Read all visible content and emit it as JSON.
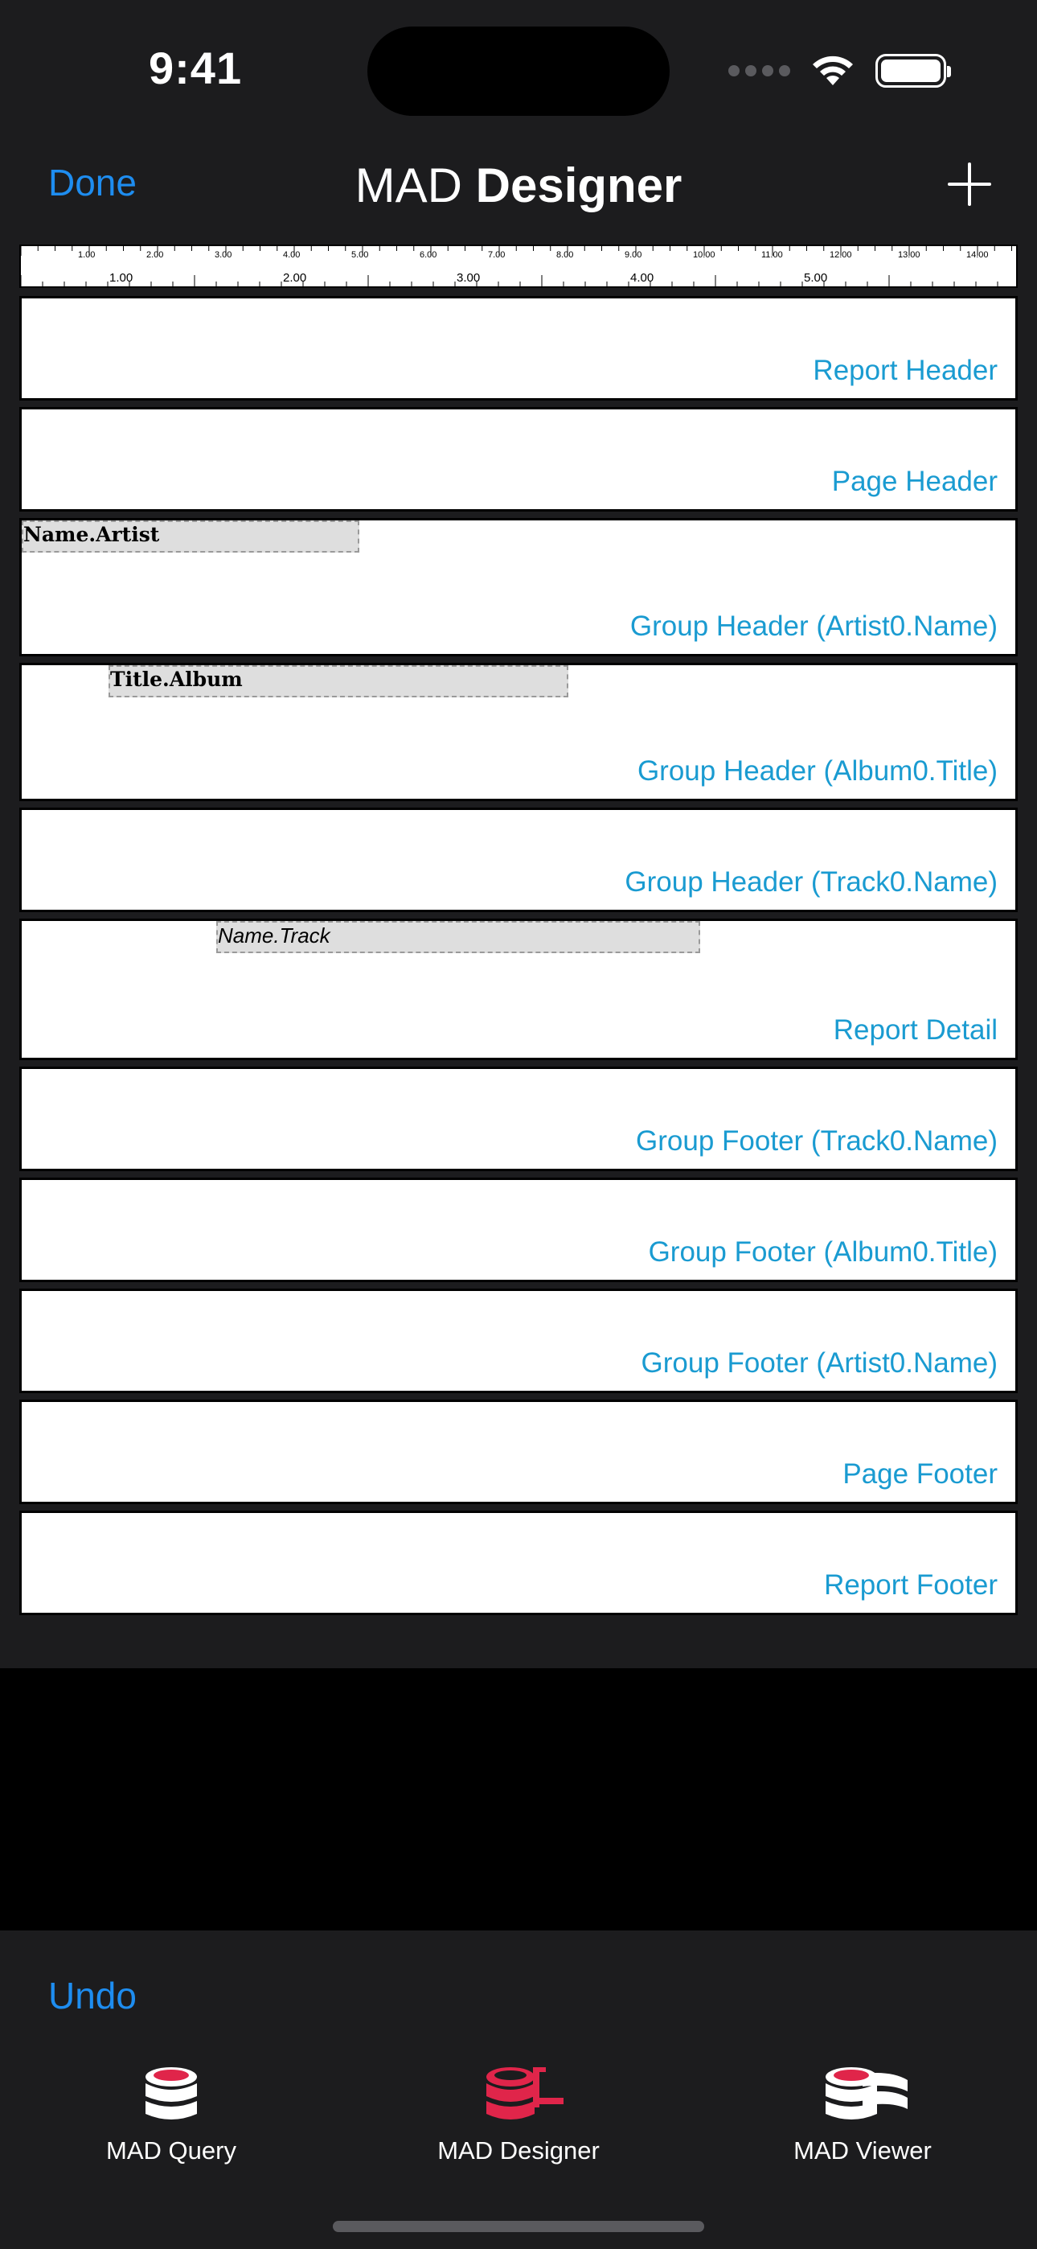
{
  "status_bar": {
    "time": "9:41"
  },
  "nav": {
    "done_label": "Done",
    "title_light": "MAD",
    "title_bold": "Designer"
  },
  "ruler": {
    "top_labels": [
      "1.00",
      "2.00",
      "3.00",
      "4.00",
      "5.00",
      "6.00",
      "7.00",
      "8.00",
      "9.00",
      "10.00",
      "11.00",
      "12.00",
      "13.00",
      "14.00"
    ],
    "bottom_labels": [
      "1.00",
      "2.00",
      "3.00",
      "4.00",
      "5.00"
    ]
  },
  "bands": [
    {
      "label": "Report Header"
    },
    {
      "label": "Page Header"
    },
    {
      "label": "Group Header (Artist0.Name)",
      "field": "Name.Artist"
    },
    {
      "label": "Group Header (Album0.Title)",
      "field": "Title.Album"
    },
    {
      "label": "Group Header (Track0.Name)"
    },
    {
      "label": "Report Detail",
      "field": "Name.Track"
    },
    {
      "label": "Group Footer (Track0.Name)"
    },
    {
      "label": "Group Footer (Album0.Title)"
    },
    {
      "label": "Group Footer (Artist0.Name)"
    },
    {
      "label": "Page Footer"
    },
    {
      "label": "Report Footer"
    }
  ],
  "toolbar": {
    "undo_label": "Undo"
  },
  "tabs": [
    {
      "label": "MAD Query",
      "icon": "database-icon"
    },
    {
      "label": "MAD Designer",
      "icon": "designer-database-icon",
      "selected": true
    },
    {
      "label": "MAD Viewer",
      "icon": "viewer-database-icon"
    }
  ],
  "colors": {
    "accent": "#1e8df0",
    "band_label": "#1a9bd1",
    "brand_red": "#e0254a"
  }
}
